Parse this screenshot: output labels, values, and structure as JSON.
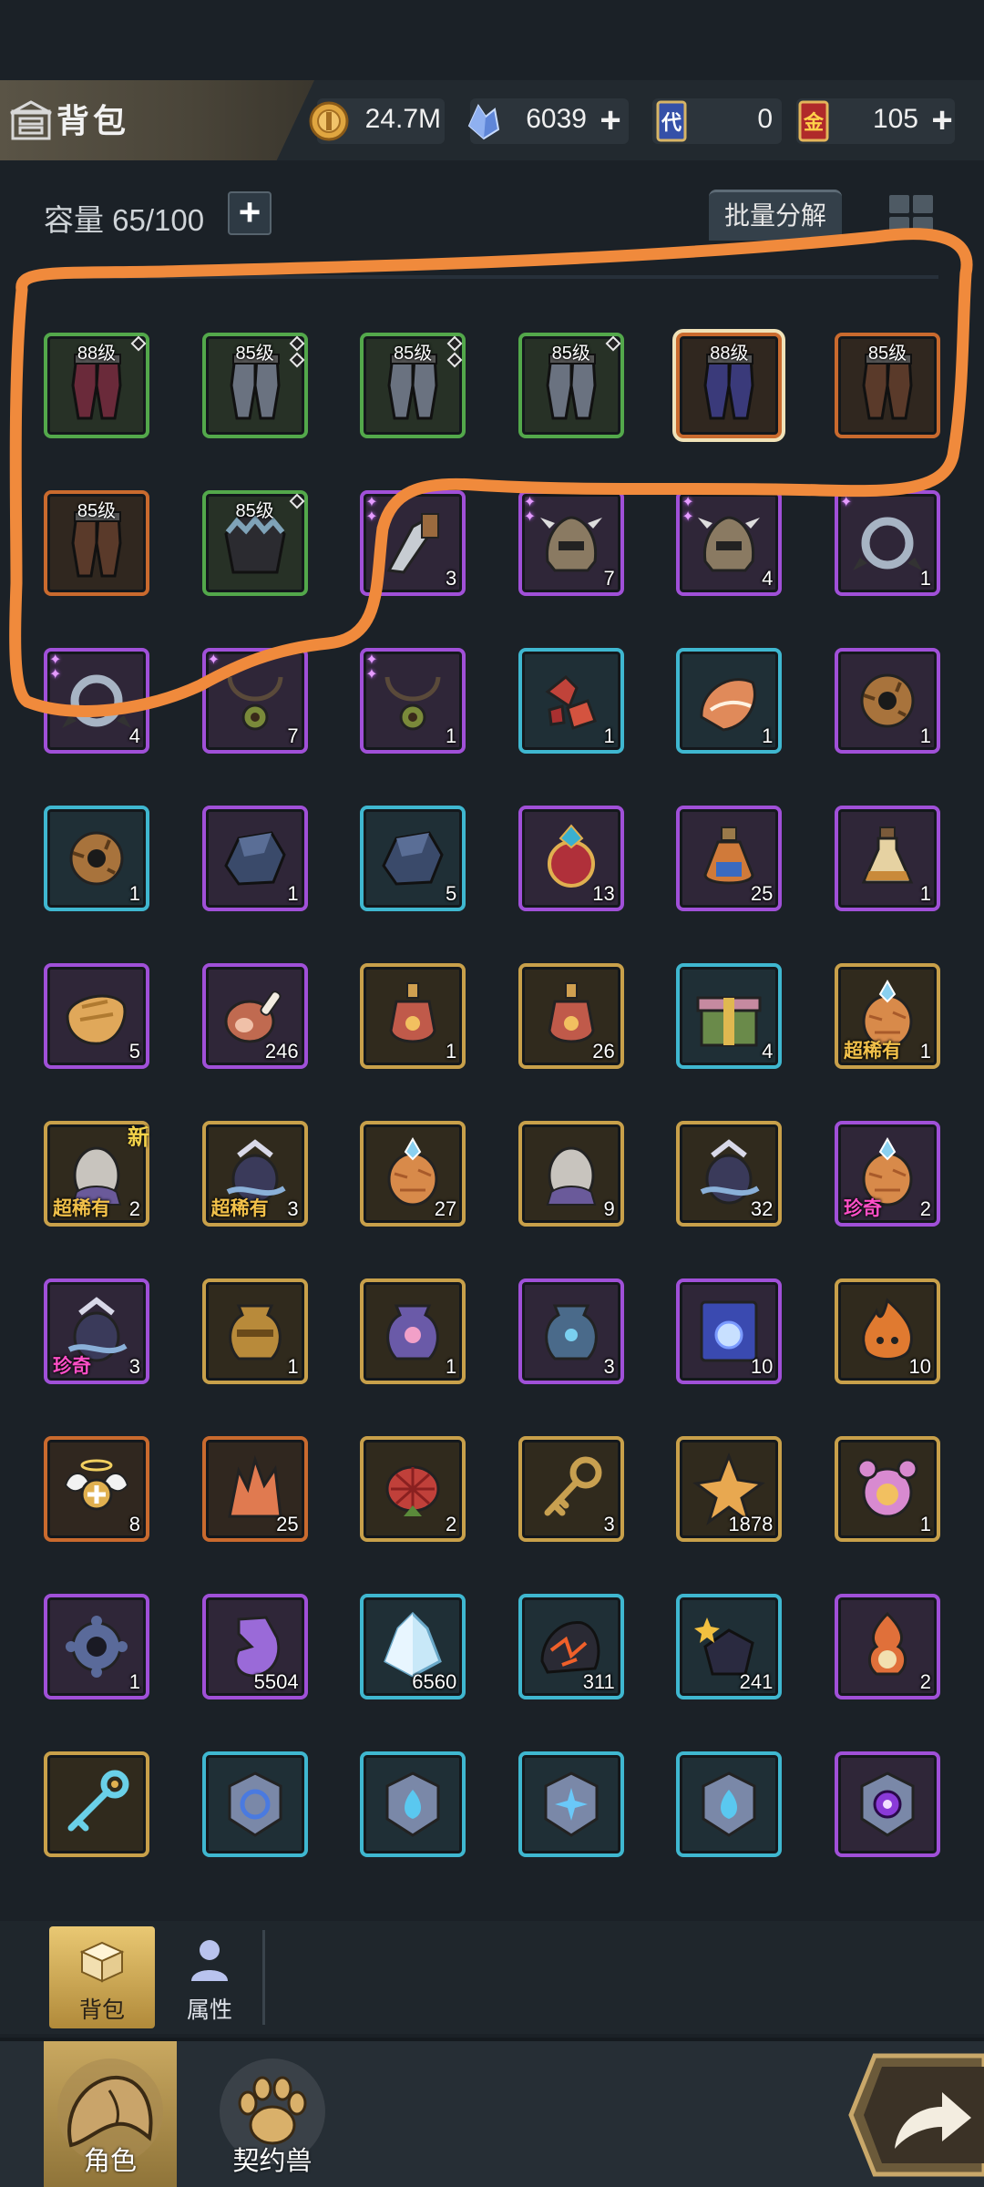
{
  "header": {
    "title": "背包",
    "currencies": [
      {
        "name": "gold-coin-icon",
        "value": "24.7M",
        "has_plus": false
      },
      {
        "name": "crystal-icon",
        "value": "6039",
        "has_plus": true
      },
      {
        "name": "voucher-card-icon",
        "value": "0",
        "has_plus": false
      },
      {
        "name": "gold-card-icon",
        "value": "105",
        "has_plus": true
      }
    ],
    "voucher_glyph": "代",
    "gold_glyph": "金",
    "plus_glyph": "+"
  },
  "toolbar": {
    "capacity_label": "容量 65/100",
    "capacity_plus": "+",
    "batch_label": "批量分解"
  },
  "items": [
    {
      "icon": "leg-armor-icon",
      "frame": "green",
      "level": "88级",
      "count": "",
      "diamond": 1,
      "stars": 0
    },
    {
      "icon": "leg-armor-icon",
      "frame": "green",
      "level": "85级",
      "count": "",
      "diamond": 2,
      "stars": 0
    },
    {
      "icon": "leg-armor-icon",
      "frame": "green",
      "level": "85级",
      "count": "",
      "diamond": 2,
      "stars": 0
    },
    {
      "icon": "leg-armor-icon",
      "frame": "green",
      "level": "85级",
      "count": "",
      "diamond": 1,
      "stars": 0
    },
    {
      "icon": "leg-armor-icon",
      "frame": "orange",
      "level": "88级",
      "count": "",
      "diamond": 0,
      "stars": 0,
      "selected": true
    },
    {
      "icon": "leg-armor-icon",
      "frame": "orange",
      "level": "85级",
      "count": "",
      "diamond": 0,
      "stars": 0
    },
    {
      "icon": "leg-armor-icon",
      "frame": "orange",
      "level": "85级",
      "count": "",
      "diamond": 0,
      "stars": 0
    },
    {
      "icon": "chest-armor-icon",
      "frame": "green",
      "level": "85级",
      "count": "",
      "diamond": 1,
      "stars": 0
    },
    {
      "icon": "claw-blade-icon",
      "frame": "purple",
      "level": "",
      "count": "3",
      "diamond": 0,
      "stars": 2
    },
    {
      "icon": "spiked-helmet-icon",
      "frame": "purple",
      "level": "",
      "count": "7",
      "diamond": 0,
      "stars": 2
    },
    {
      "icon": "spiked-helmet-icon",
      "frame": "purple",
      "level": "",
      "count": "4",
      "diamond": 0,
      "stars": 2
    },
    {
      "icon": "spiked-ring-icon",
      "frame": "purple",
      "level": "",
      "count": "1",
      "diamond": 0,
      "stars": 1
    },
    {
      "icon": "spiked-ring-icon",
      "frame": "purple",
      "level": "",
      "count": "4",
      "diamond": 0,
      "stars": 2
    },
    {
      "icon": "necklace-icon",
      "frame": "purple",
      "level": "",
      "count": "7",
      "diamond": 0,
      "stars": 1
    },
    {
      "icon": "necklace-icon",
      "frame": "purple",
      "level": "",
      "count": "1",
      "diamond": 0,
      "stars": 2
    },
    {
      "icon": "red-ore-icon",
      "frame": "blue",
      "level": "",
      "count": "1",
      "diamond": 0,
      "stars": 0
    },
    {
      "icon": "orange-ore-icon",
      "frame": "blue",
      "level": "",
      "count": "1",
      "diamond": 0,
      "stars": 0
    },
    {
      "icon": "donut-ring-icon",
      "frame": "purple",
      "level": "",
      "count": "1",
      "diamond": 0,
      "stars": 0
    },
    {
      "icon": "donut-ring-icon",
      "frame": "blue",
      "level": "",
      "count": "1",
      "diamond": 0,
      "stars": 0
    },
    {
      "icon": "dark-stone-icon",
      "frame": "purple",
      "level": "",
      "count": "1",
      "diamond": 0,
      "stars": 0
    },
    {
      "icon": "dark-stone-icon",
      "frame": "blue",
      "level": "",
      "count": "5",
      "diamond": 0,
      "stars": 0
    },
    {
      "icon": "jewel-orb-icon",
      "frame": "purple",
      "level": "",
      "count": "13",
      "diamond": 0,
      "stars": 0
    },
    {
      "icon": "potion-bottle-icon",
      "frame": "purple",
      "level": "",
      "count": "25",
      "diamond": 0,
      "stars": 0
    },
    {
      "icon": "potion-flask-icon",
      "frame": "purple",
      "level": "",
      "count": "1",
      "diamond": 0,
      "stars": 0
    },
    {
      "icon": "bread-icon",
      "frame": "purple",
      "level": "",
      "count": "5",
      "diamond": 0,
      "stars": 0
    },
    {
      "icon": "meat-leg-icon",
      "frame": "purple",
      "level": "",
      "count": "246",
      "diamond": 0,
      "stars": 0
    },
    {
      "icon": "elixir-icon",
      "frame": "gold",
      "level": "",
      "count": "1",
      "diamond": 0,
      "stars": 0
    },
    {
      "icon": "elixir-icon",
      "frame": "gold",
      "level": "",
      "count": "26",
      "diamond": 0,
      "stars": 0
    },
    {
      "icon": "gift-box-icon",
      "frame": "blue",
      "level": "",
      "count": "4",
      "diamond": 0,
      "stars": 0
    },
    {
      "icon": "egg-crystal-icon",
      "frame": "gold",
      "level": "",
      "count": "1",
      "diamond": 0,
      "stars": 0,
      "tag": "超稀有",
      "tag_type": "sup"
    },
    {
      "icon": "egg-gray-icon",
      "frame": "gold",
      "level": "",
      "count": "2",
      "diamond": 0,
      "stars": 0,
      "tag": "超稀有",
      "tag_type": "sup",
      "new": "新"
    },
    {
      "icon": "egg-feather-icon",
      "frame": "gold",
      "level": "",
      "count": "3",
      "diamond": 0,
      "stars": 0,
      "tag": "超稀有",
      "tag_type": "sup"
    },
    {
      "icon": "egg-crystal-icon",
      "frame": "gold",
      "level": "",
      "count": "27",
      "diamond": 0,
      "stars": 0
    },
    {
      "icon": "egg-gray-icon",
      "frame": "gold",
      "level": "",
      "count": "9",
      "diamond": 0,
      "stars": 0
    },
    {
      "icon": "egg-feather-icon",
      "frame": "gold",
      "level": "",
      "count": "32",
      "diamond": 0,
      "stars": 0
    },
    {
      "icon": "egg-crystal-icon",
      "frame": "purple",
      "level": "",
      "count": "2",
      "diamond": 0,
      "stars": 0,
      "tag": "珍奇",
      "tag_type": "rare"
    },
    {
      "icon": "egg-feather-icon",
      "frame": "purple",
      "level": "",
      "count": "3",
      "diamond": 0,
      "stars": 0,
      "tag": "珍奇",
      "tag_type": "rare"
    },
    {
      "icon": "golden-urn-icon",
      "frame": "gold",
      "level": "",
      "count": "1",
      "diamond": 0,
      "stars": 0
    },
    {
      "icon": "purple-urn-icon",
      "frame": "gold",
      "level": "",
      "count": "1",
      "diamond": 0,
      "stars": 0
    },
    {
      "icon": "blue-urn-icon",
      "frame": "purple",
      "level": "",
      "count": "3",
      "diamond": 0,
      "stars": 0
    },
    {
      "icon": "scroll-icon",
      "frame": "purple",
      "level": "",
      "count": "10",
      "diamond": 0,
      "stars": 0
    },
    {
      "icon": "fire-spirit-icon",
      "frame": "gold",
      "level": "",
      "count": "10",
      "diamond": 0,
      "stars": 0
    },
    {
      "icon": "winged-halo-icon",
      "frame": "orange",
      "level": "",
      "count": "8",
      "diamond": 0,
      "stars": 0
    },
    {
      "icon": "crystal-shard-icon",
      "frame": "orange",
      "level": "",
      "count": "25",
      "diamond": 0,
      "stars": 0
    },
    {
      "icon": "red-flower-icon",
      "frame": "gold",
      "level": "",
      "count": "2",
      "diamond": 0,
      "stars": 0
    },
    {
      "icon": "key-icon",
      "frame": "gold",
      "level": "",
      "count": "3",
      "diamond": 0,
      "stars": 0
    },
    {
      "icon": "star-crystal-icon",
      "frame": "gold",
      "level": "",
      "count": "1878",
      "diamond": 0,
      "stars": 0
    },
    {
      "icon": "bear-coin-icon",
      "frame": "gold",
      "level": "",
      "count": "1",
      "diamond": 0,
      "stars": 0
    },
    {
      "icon": "gear-ring-icon",
      "frame": "purple",
      "level": "",
      "count": "1",
      "diamond": 0,
      "stars": 0
    },
    {
      "icon": "purple-gem-icon",
      "frame": "purple",
      "level": "",
      "count": "5504",
      "diamond": 0,
      "stars": 0
    },
    {
      "icon": "ice-crystal-icon",
      "frame": "blue",
      "level": "",
      "count": "6560",
      "diamond": 0,
      "stars": 0
    },
    {
      "icon": "lava-rock-icon",
      "frame": "blue",
      "level": "",
      "count": "311",
      "diamond": 0,
      "stars": 0
    },
    {
      "icon": "spark-rock-icon",
      "frame": "blue",
      "level": "",
      "count": "241",
      "diamond": 0,
      "stars": 0
    },
    {
      "icon": "flame-lamp-icon",
      "frame": "purple",
      "level": "",
      "count": "2",
      "diamond": 0,
      "stars": 0
    },
    {
      "icon": "magic-key-icon",
      "frame": "gold",
      "level": "",
      "count": "",
      "diamond": 0,
      "stars": 0
    },
    {
      "icon": "rune-stone-swirl-icon",
      "frame": "blue",
      "level": "",
      "count": "",
      "diamond": 0,
      "stars": 0
    },
    {
      "icon": "rune-stone-drop-icon",
      "frame": "blue",
      "level": "",
      "count": "",
      "diamond": 0,
      "stars": 0
    },
    {
      "icon": "rune-stone-star-icon",
      "frame": "blue",
      "level": "",
      "count": "",
      "diamond": 0,
      "stars": 0
    },
    {
      "icon": "rune-stone-drop-icon",
      "frame": "blue",
      "level": "",
      "count": "",
      "diamond": 0,
      "stars": 0
    },
    {
      "icon": "rune-stone-void-icon",
      "frame": "purple",
      "level": "",
      "count": "",
      "diamond": 0,
      "stars": 0
    }
  ],
  "subnav": {
    "bag_label": "背包",
    "attributes_label": "属性"
  },
  "bottom_nav": {
    "character_label": "角色",
    "pet_label": "契约兽"
  },
  "colors": {
    "annotation_stroke": "#f08a3c",
    "frame_green": "#53a84b",
    "frame_orange": "#c96a2e",
    "frame_purple": "#a050d8",
    "frame_blue": "#3fb7d0",
    "frame_gold": "#c8a04a"
  }
}
